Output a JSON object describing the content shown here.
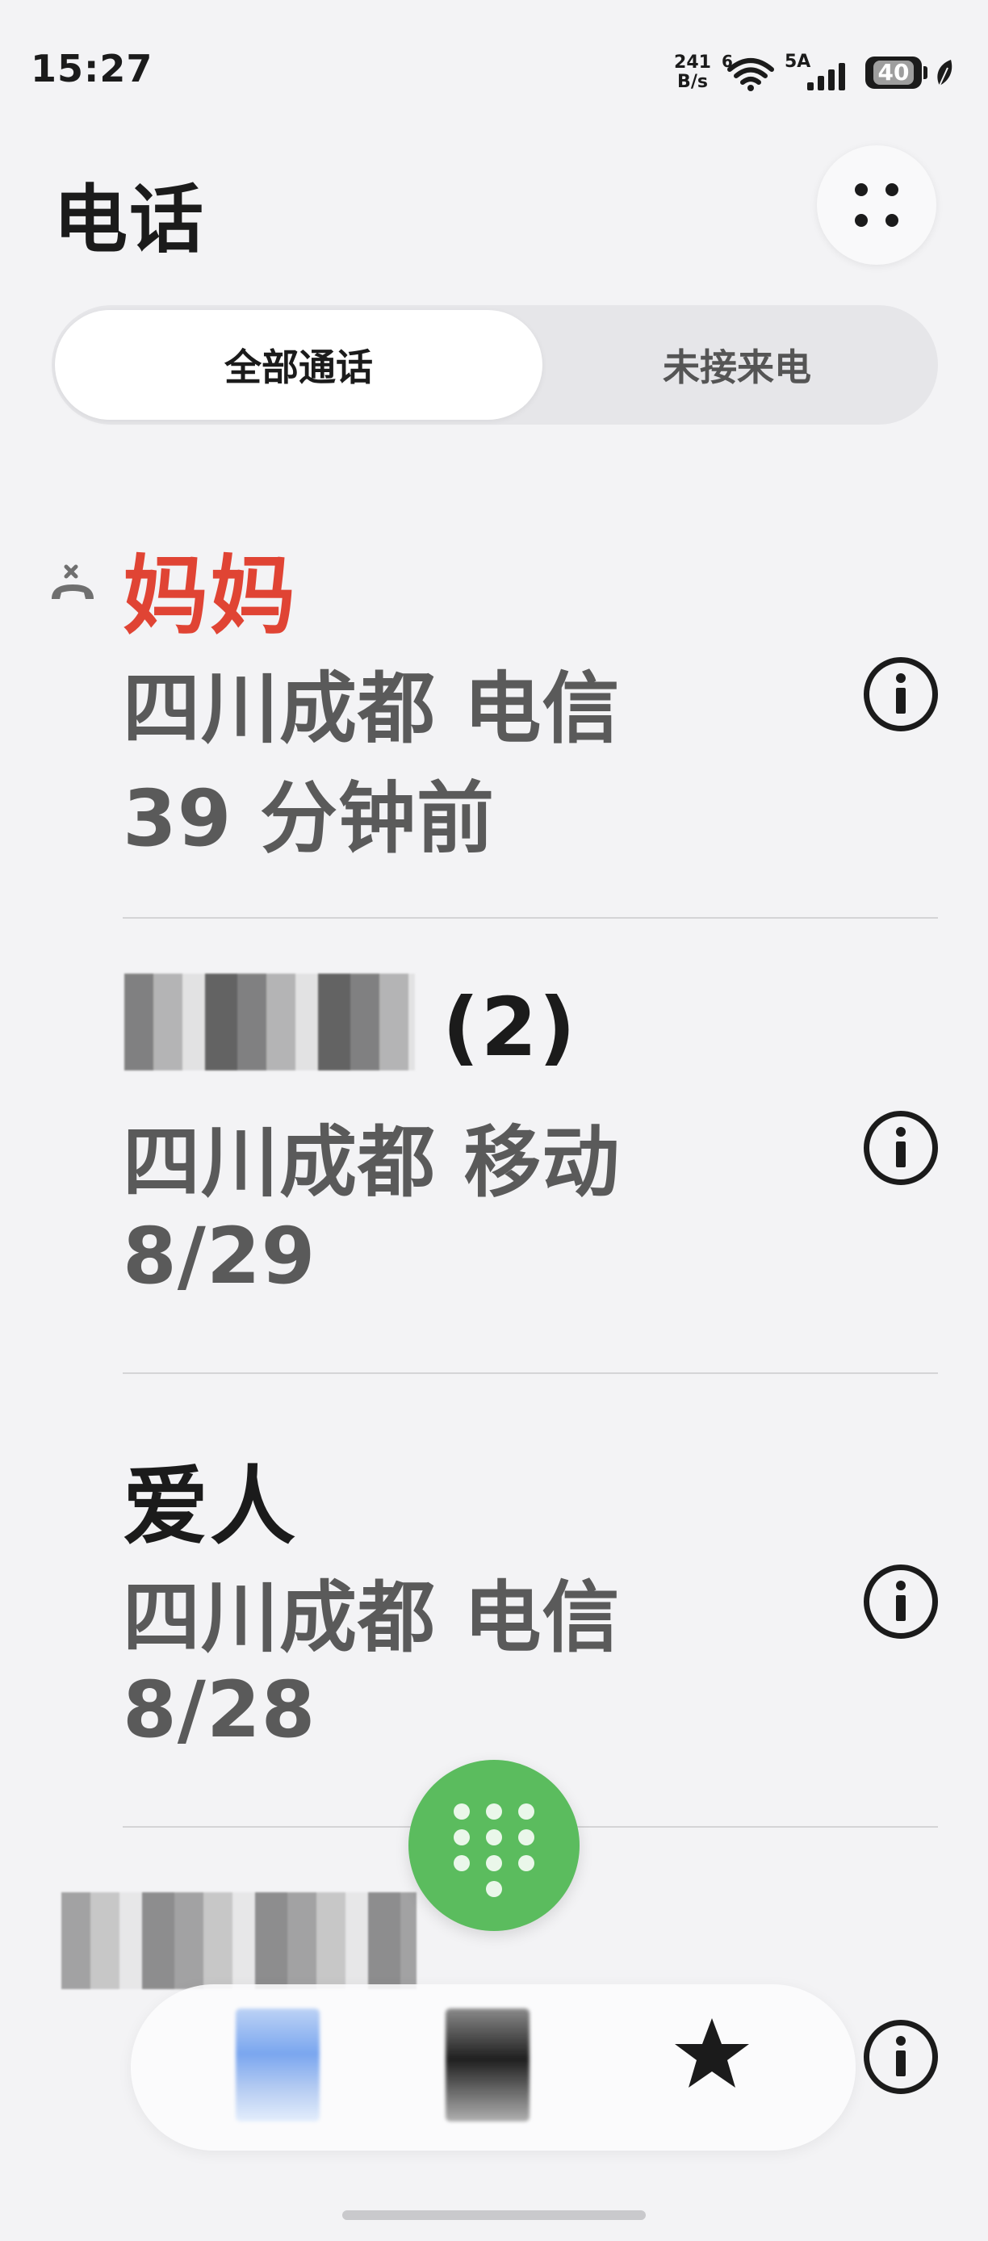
{
  "status_bar": {
    "time": "15:27",
    "net_speed_value": "241",
    "net_speed_unit": "B/s",
    "wifi_label": "6",
    "cell_label": "5A",
    "battery": "40"
  },
  "header": {
    "title": "电话",
    "more_icon": "four-dots-icon"
  },
  "tabs": [
    {
      "label": "全部通话",
      "selected": true
    },
    {
      "label": "未接来电",
      "selected": false
    }
  ],
  "calls": [
    {
      "name": "妈妈",
      "location": "四川成都 电信",
      "time": "39 分钟前",
      "missed": true,
      "name_color": "#e04434"
    },
    {
      "name": "(2)",
      "location": "四川成都 移动",
      "time": "8/29",
      "missed": false,
      "name_obscured": true
    },
    {
      "name": "爱人",
      "location": "四川成都 电信",
      "time": "8/28",
      "missed": false
    }
  ],
  "colors": {
    "missed_red": "#e04434",
    "dial_green": "#5bbc5e",
    "background": "#f3f3f5"
  },
  "bottom_nav": {
    "favorites_icon": "star-icon"
  },
  "dial_icon": "dialpad-icon"
}
